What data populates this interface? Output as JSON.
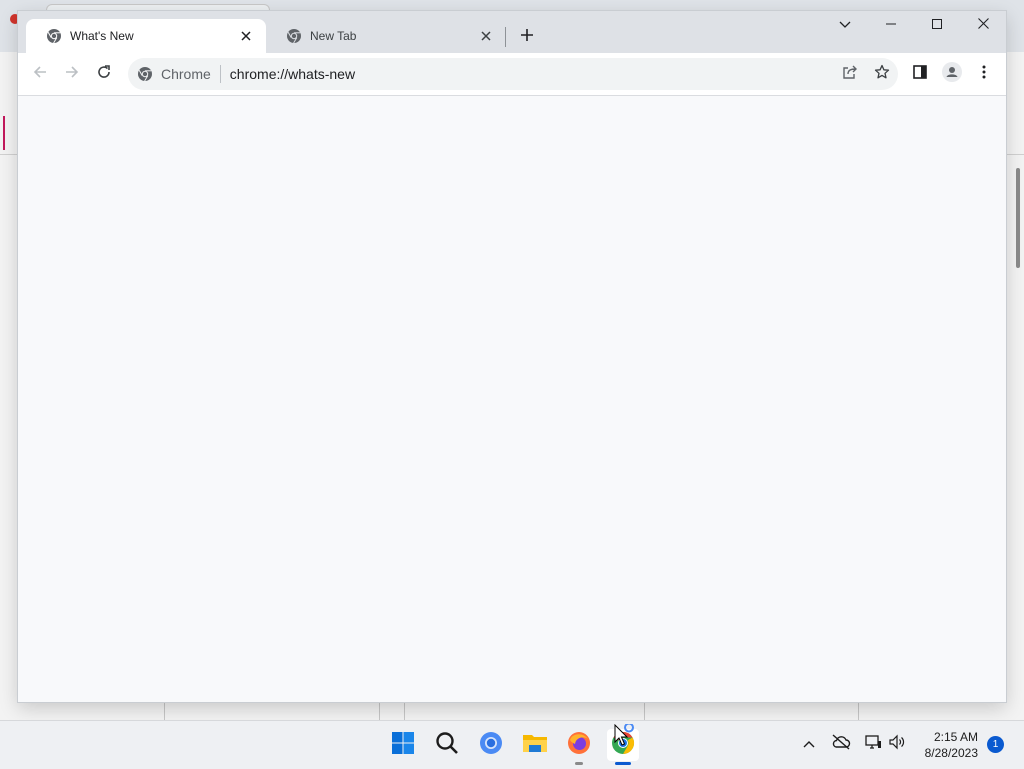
{
  "browser": {
    "tabs": [
      {
        "label": "What's New",
        "active": true,
        "favicon": "chrome-icon"
      },
      {
        "label": "New Tab",
        "active": false,
        "favicon": "chrome-icon"
      }
    ],
    "new_tab_icon": "plus-icon",
    "window_controls": [
      "tab-search-icon",
      "minimize-icon",
      "maximize-icon",
      "close-icon"
    ],
    "toolbar": {
      "back_icon": "arrow-left-icon",
      "forward_icon": "arrow-right-icon",
      "reload_icon": "reload-icon",
      "site_label": "Chrome",
      "url": "chrome://whats-new",
      "share_icon": "share-icon",
      "bookmark_icon": "star-icon",
      "side_panel_icon": "side-panel-icon",
      "profile_icon": "profile-icon",
      "menu_icon": "kebab-menu-icon"
    }
  },
  "taskbar": {
    "apps": [
      "windows-start-icon",
      "search-icon",
      "chromium-icon",
      "file-explorer-icon",
      "firefox-icon",
      "chrome-icon"
    ],
    "tray": [
      "chevron-up-icon",
      "cloud-offline-icon",
      "network-icon",
      "volume-icon"
    ],
    "time": "2:15 AM",
    "date": "8/28/2023",
    "notification_count": "1"
  },
  "colors": {
    "tabstrip": "#dee1e6",
    "toolbar": "#ffffff",
    "omnibox": "#f1f3f4",
    "page_background": "#f8f9fb",
    "taskbar": "#eef0f3",
    "accent": "#0a5ad0"
  }
}
